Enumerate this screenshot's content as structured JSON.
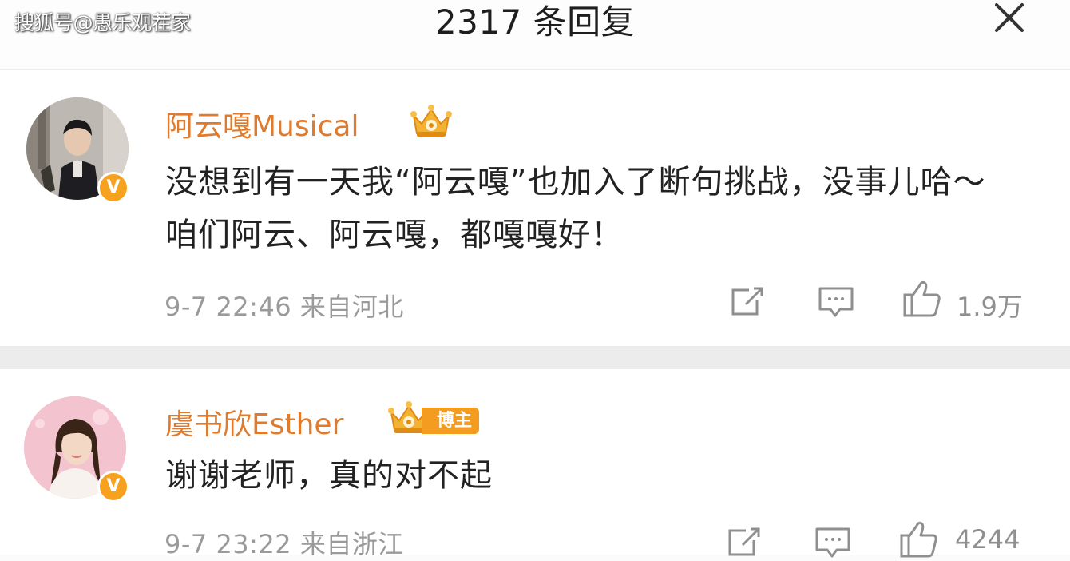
{
  "watermark": "搜狐号@愚乐观茬家",
  "header": {
    "title": "2317 条回复"
  },
  "comments": [
    {
      "username": "阿云嘎Musical",
      "text": "没想到有一天我“阿云嘎”也加入了断句挑战，没事儿哈～咱们阿云、阿云嘎，都嘎嘎好！",
      "time": "9-7 22:46",
      "location": "来自河北",
      "likes": "1.9万",
      "verified_badge": "V",
      "member_icon": "crown-icon"
    },
    {
      "username": "虞书欣Esther",
      "badge_label": "博主",
      "text": "谢谢老师，真的对不起",
      "time": "9-7 23:22",
      "location": "来自浙江",
      "likes": "4244",
      "verified_badge": "V",
      "member_icon": "crown-icon"
    }
  ],
  "icons": {
    "close": "close-icon",
    "share": "share-icon",
    "reply": "comment-icon",
    "like": "thumbs-up-icon"
  },
  "colors": {
    "username": "#e07a2c",
    "badge": "#f39c1f",
    "meta": "#9a9a9a",
    "separator": "#ececec"
  }
}
